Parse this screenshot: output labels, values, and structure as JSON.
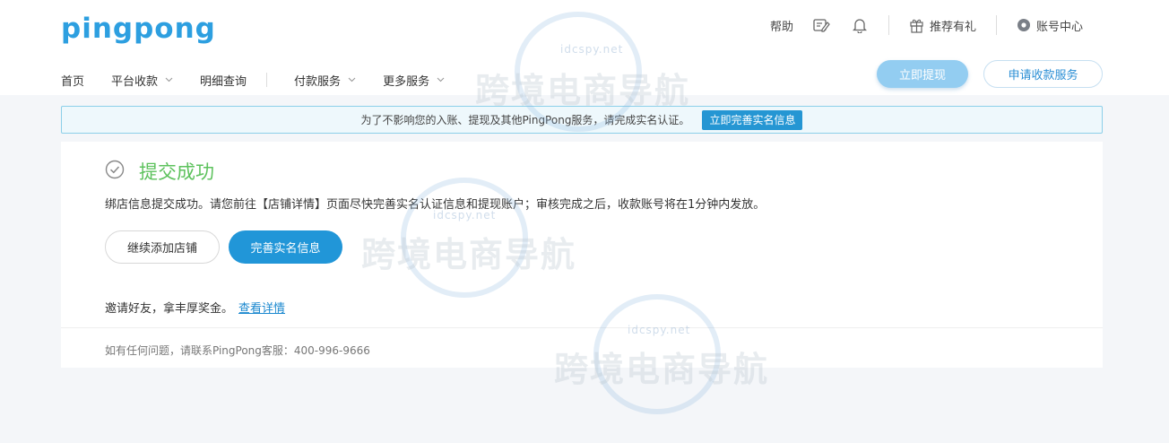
{
  "header": {
    "logo": "pingpong",
    "help": "帮助",
    "recommend": "推荐有礼",
    "account": "账号中心"
  },
  "nav": {
    "home": "首页",
    "platform_collection": "平台收款",
    "details": "明细查询",
    "payment_service": "付款服务",
    "more_service": "更多服务"
  },
  "actions": {
    "withdraw": "立即提现",
    "apply": "申请收款服务"
  },
  "notice": {
    "text": "为了不影响您的入账、提现及其他PingPong服务，请完成实名认证。",
    "button": "立即完善实名信息"
  },
  "result": {
    "title": "提交成功",
    "description": "绑店信息提交成功。请您前往【店铺详情】页面尽快完善实名认证信息和提现账户；审核完成之后，收款账号将在1分钟内发放。",
    "continue_button": "继续添加店铺",
    "complete_button": "完善实名信息",
    "invite_text": "邀请好友，拿丰厚奖金。",
    "invite_link": "查看详情",
    "contact": "如有任何问题，请联系PingPong客服：400-996-9666"
  },
  "watermark": {
    "text": "跨境电商导航",
    "sub": "idcspy.net"
  },
  "colors": {
    "brand": "#2d9fe0",
    "success": "#5dc25d",
    "primary_button": "#2196d8"
  }
}
